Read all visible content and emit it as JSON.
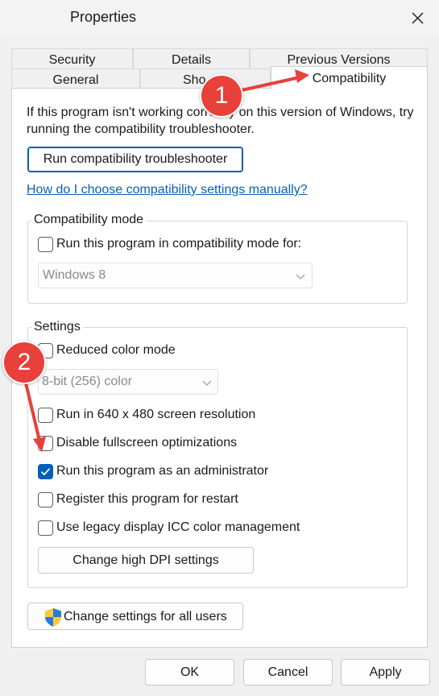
{
  "window": {
    "title": "Properties"
  },
  "tabs": {
    "row1": [
      {
        "label": "Security"
      },
      {
        "label": "Details"
      },
      {
        "label": "Previous Versions"
      }
    ],
    "row2": [
      {
        "label": "General"
      },
      {
        "label": "Sho"
      },
      {
        "label": "Compatibility",
        "active": true
      }
    ]
  },
  "intro": {
    "line1": "If this program isn't working correctly on this version of Windows, try",
    "line2": "running the compatibility troubleshooter."
  },
  "troubleshooter_button": "Run compatibility troubleshooter",
  "help_link": "How do I choose compatibility settings manually?",
  "compat_mode": {
    "legend": "Compatibility mode",
    "checkbox_label": "Run this program in compatibility mode for:",
    "checked": false,
    "selected_os": "Windows 8"
  },
  "settings": {
    "legend": "Settings",
    "reduced_color": {
      "label": "Reduced color mode",
      "checked": false
    },
    "color_dropdown": "8-bit (256) color",
    "res_640": {
      "label": "Run in 640 x 480 screen resolution",
      "checked": false
    },
    "fullscreen_opt": {
      "label": "Disable fullscreen optimizations",
      "checked": false
    },
    "run_as_admin": {
      "label": "Run this program as an administrator",
      "checked": true
    },
    "register_restart": {
      "label": "Register this program for restart",
      "checked": false
    },
    "legacy_icc": {
      "label": "Use legacy display ICC color management",
      "checked": false
    },
    "dpi_button": "Change high DPI settings"
  },
  "all_users_button": "Change settings for all users",
  "footer": {
    "ok": "OK",
    "cancel": "Cancel",
    "apply": "Apply"
  },
  "annotations": {
    "marker1": "1",
    "marker2": "2"
  },
  "colors": {
    "accent": "#005fb8",
    "link": "#0a5fb4",
    "annotation": "#e8403b"
  }
}
